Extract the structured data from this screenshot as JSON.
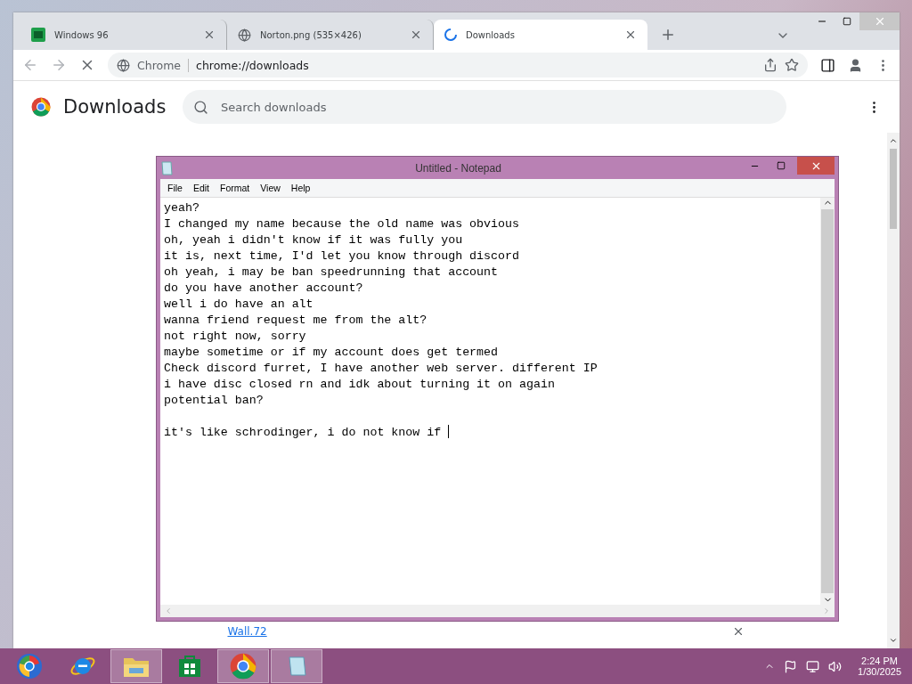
{
  "browser": {
    "tabs": [
      {
        "kind": "app",
        "title": "Windows 96",
        "selected": false
      },
      {
        "kind": "globe",
        "title": "Norton.png (535×426)",
        "selected": false
      },
      {
        "kind": "loading",
        "title": "Downloads",
        "selected": true
      }
    ],
    "omnibox": {
      "site": "Chrome",
      "url": "chrome://downloads"
    },
    "page": {
      "title": "Downloads",
      "search": {
        "placeholder": "Search downloads"
      },
      "item_link": "Wall.72"
    }
  },
  "notepad": {
    "title": "Untitled - Notepad",
    "menu": [
      "File",
      "Edit",
      "Format",
      "View",
      "Help"
    ],
    "content": "yeah?\nI changed my name because the old name was obvious\noh, yeah i didn't know if it was fully you\nit is, next time, I'd let you know through discord\noh yeah, i may be ban speedrunning that account\ndo you have another account?\nwell i do have an alt\nwanna friend request me from the alt?\nnot right now, sorry\nmaybe sometime or if my account does get termed\nCheck discord furret, I have another web server. different IP\ni have disc closed rn and idk about turning it on again\npotential ban?\n\nit's like schrodinger, i do not know if "
  },
  "taskbar": {
    "items": [
      {
        "kind": "start",
        "open": false
      },
      {
        "kind": "ie",
        "open": false
      },
      {
        "kind": "explorer",
        "open": true
      },
      {
        "kind": "store",
        "open": false
      },
      {
        "kind": "chrome",
        "open": true
      },
      {
        "kind": "notepad",
        "open": true
      }
    ],
    "clock": {
      "time": "2:24 PM",
      "date": "1/30/2025"
    }
  }
}
